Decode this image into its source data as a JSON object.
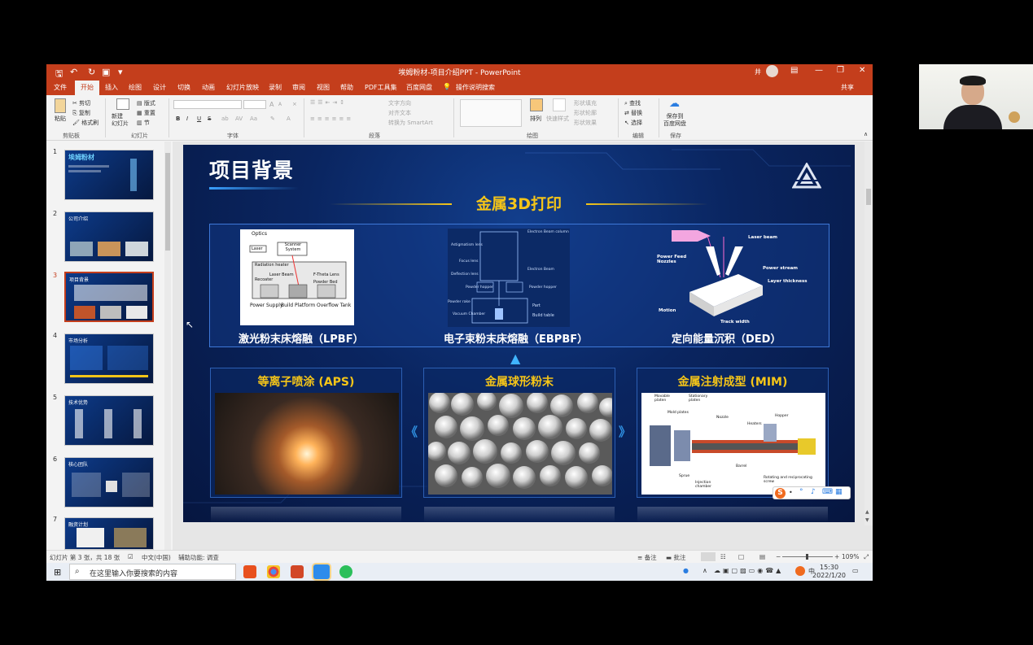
{
  "window": {
    "doc_title": "埃姆粉材-项目介绍PPT - PowerPoint",
    "user_initial": "井",
    "share_label": "共享"
  },
  "tabs": [
    {
      "label": "文件",
      "active": false
    },
    {
      "label": "开始",
      "active": true
    },
    {
      "label": "插入",
      "active": false
    },
    {
      "label": "绘图",
      "active": false
    },
    {
      "label": "设计",
      "active": false
    },
    {
      "label": "切换",
      "active": false
    },
    {
      "label": "动画",
      "active": false
    },
    {
      "label": "幻灯片放映",
      "active": false
    },
    {
      "label": "录制",
      "active": false
    },
    {
      "label": "审阅",
      "active": false
    },
    {
      "label": "视图",
      "active": false
    },
    {
      "label": "帮助",
      "active": false
    },
    {
      "label": "PDF工具集",
      "active": false
    },
    {
      "label": "百度网盘",
      "active": false
    },
    {
      "label": "操作说明搜索",
      "active": false
    }
  ],
  "ribbon": {
    "clipboard": {
      "paste": "粘贴",
      "cut": "剪切",
      "copy": "复制",
      "format_painter": "格式刷",
      "label": "剪贴板"
    },
    "slides": {
      "new_slide": "新建\n幻灯片",
      "layout": "版式",
      "reset": "重置",
      "section": "节",
      "label": "幻灯片"
    },
    "font": {
      "label": "字体",
      "bold": "B",
      "italic": "I",
      "underline": "U",
      "strike": "S",
      "spacing": "AV",
      "case": "Aa",
      "size_up": "A",
      "size_down": "A"
    },
    "paragraph": {
      "label": "段落",
      "text_direction": "文字方向",
      "align_text": "对齐文本",
      "smartart": "转换为 SmartArt"
    },
    "drawing": {
      "label": "绘图",
      "arrange": "排列",
      "quick_styles": "快速样式",
      "shape_fill": "形状填充",
      "shape_outline": "形状轮廓",
      "shape_effects": "形状效果"
    },
    "editing": {
      "label": "编辑",
      "find": "查找",
      "replace": "替换",
      "select": "选择"
    },
    "save": {
      "label": "保存",
      "save_to": "保存到\n百度网盘"
    }
  },
  "thumbnails": [
    {
      "num": "1",
      "title": "埃姆粉材"
    },
    {
      "num": "2",
      "title": "公司介绍"
    },
    {
      "num": "3",
      "title": "项目背景"
    },
    {
      "num": "4",
      "title": "市场分析"
    },
    {
      "num": "5",
      "title": "技术优势"
    },
    {
      "num": "6",
      "title": "核心团队"
    },
    {
      "num": "7",
      "title": "融资计划"
    }
  ],
  "slide": {
    "title": "项目背景",
    "main_heading": "金属3D打印",
    "processes": [
      {
        "caption": "激光粉末床熔融（LPBF）"
      },
      {
        "caption": "电子束粉末床熔融（EBPBF）"
      },
      {
        "caption": "定向能量沉积（DED）"
      }
    ],
    "lpbf_labels": [
      "Optics",
      "Laser",
      "Scanner System",
      "Radiation heater",
      "Laser Beam",
      "Recoater",
      "F-Theta Lens",
      "Powder Bed",
      "Power Supply",
      "Build Platform",
      "Overflow Tank"
    ],
    "ebpbf_labels": [
      "Electron Beam column",
      "Astigmatism lens",
      "Focus lens",
      "Deflection lens",
      "Electron Beam",
      "Powder hopper",
      "Powder hopper",
      "Powder rake",
      "Part",
      "Vacuum Chamber",
      "Build table"
    ],
    "ded_labels": [
      "Laser beam",
      "Power Feed Nozzles",
      "Power stream",
      "Layer thickness",
      "Motion",
      "Track width"
    ],
    "cards": [
      {
        "title": "等离子喷涂 (APS)"
      },
      {
        "title": "金属球形粉末"
      },
      {
        "title": "金属注射成型 (MIM)"
      }
    ],
    "mim_labels": [
      "Movable platen",
      "Stationary platen",
      "Mold plates",
      "Nozzle",
      "Heaters",
      "Hopper",
      "Barrel",
      "Sprue",
      "Injection chamber",
      "Rotating and reciprocating screw"
    ]
  },
  "statusbar": {
    "slide_info": "幻灯片 第 3 张，共 18 张",
    "language": "中文(中国)",
    "accessibility": "辅助功能: 调查",
    "notes": "备注",
    "comments": "批注",
    "zoom": "109%"
  },
  "taskbar": {
    "search_placeholder": "在这里输入你要搜索的内容",
    "time": "15:30",
    "date": "2022/1/20"
  },
  "colors": {
    "accent": "#c43e1c",
    "slide_bg": "#0a2560",
    "heading_gold": "#f5c518"
  }
}
